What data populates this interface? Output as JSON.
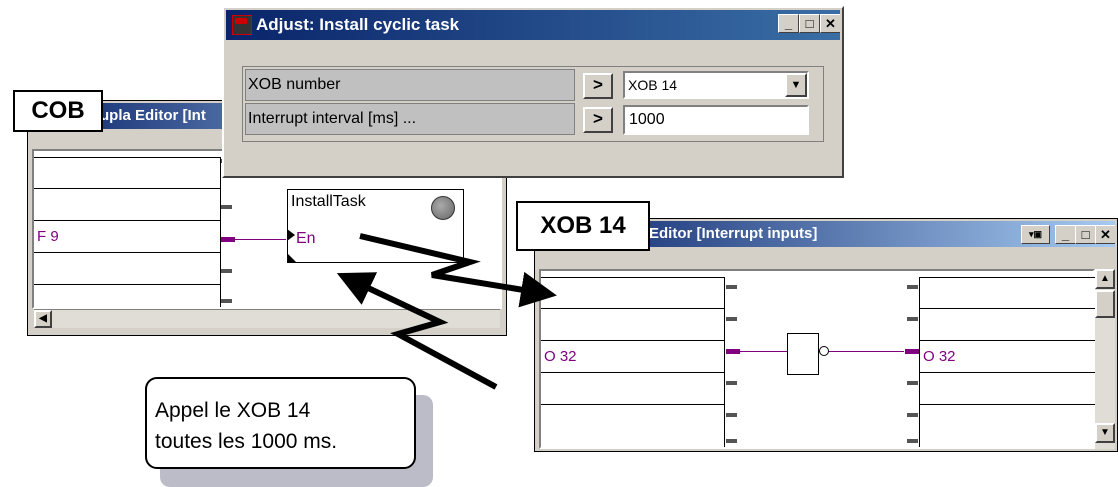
{
  "cob_window": {
    "title": "upla Editor [Int",
    "callout": "COB",
    "rows": [
      "",
      "",
      "F 9",
      "",
      ""
    ],
    "function_block": {
      "name": "InstallTask",
      "input": "En"
    }
  },
  "xob_window": {
    "title": "Editor [Interrupt inputs]",
    "callout": "XOB 14",
    "left_rows": [
      "",
      "",
      "O 32",
      "",
      ""
    ],
    "right_rows": [
      "",
      "",
      "O 32",
      "",
      ""
    ]
  },
  "dialog": {
    "title": "Adjust: Install cyclic task",
    "fields": [
      {
        "label": "XOB number",
        "button": ">",
        "value": "XOB 14"
      },
      {
        "label": "Interrupt interval [ms] ...",
        "button": ">",
        "value": "1000"
      }
    ]
  },
  "note": {
    "line1": "Appel le XOB 14",
    "line2": "toutes les 1000 ms."
  },
  "window_buttons": {
    "minimize": "_",
    "maximize": "□",
    "close": "✕"
  },
  "colors": {
    "title_start": "#0a246a",
    "title_end": "#a6caf0",
    "signal": "#800080",
    "window": "#d4d0c8"
  }
}
